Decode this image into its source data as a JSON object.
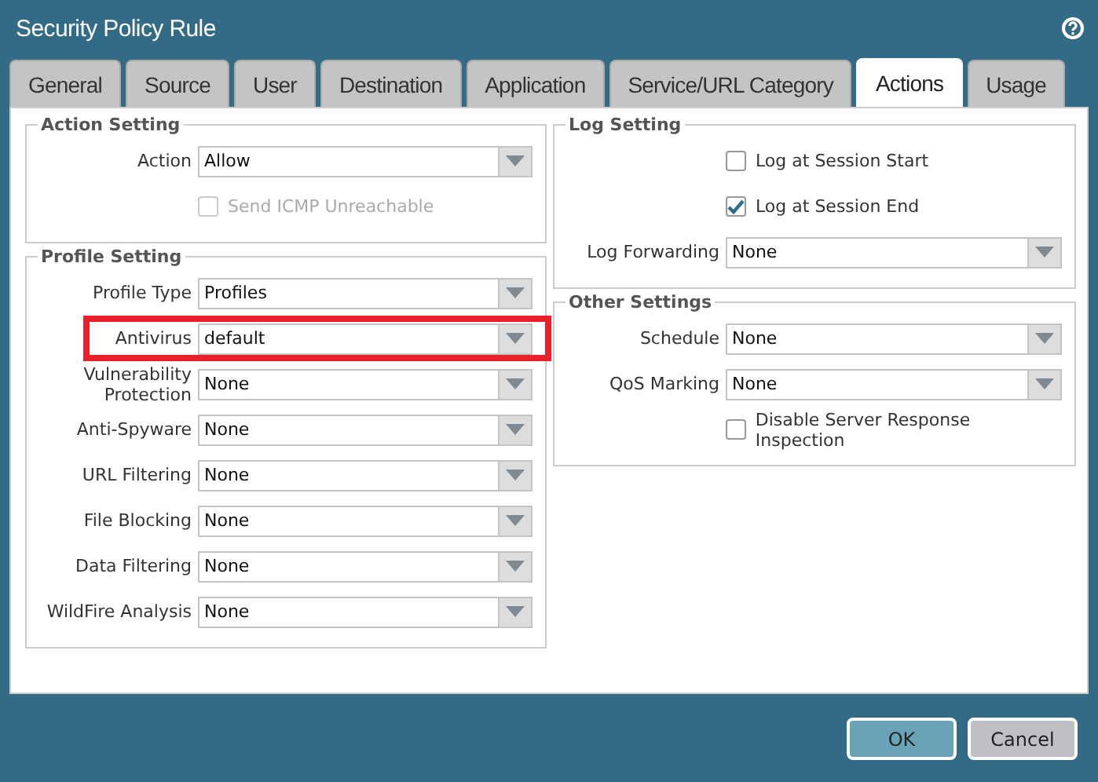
{
  "window": {
    "title": "Security Policy Rule"
  },
  "tabs": [
    {
      "label": "General",
      "selected": false
    },
    {
      "label": "Source",
      "selected": false
    },
    {
      "label": "User",
      "selected": false
    },
    {
      "label": "Destination",
      "selected": false
    },
    {
      "label": "Application",
      "selected": false
    },
    {
      "label": "Service/URL Category",
      "selected": false
    },
    {
      "label": "Actions",
      "selected": true
    },
    {
      "label": "Usage",
      "selected": false
    }
  ],
  "left_sections": [
    {
      "title": "Action Setting",
      "rows": [
        {
          "kind": "select",
          "label": "Action",
          "value": "Allow"
        },
        {
          "kind": "checkbox",
          "label": "Send ICMP Unreachable",
          "checked": false,
          "disabled": true
        }
      ]
    },
    {
      "title": "Profile Setting",
      "rows": [
        {
          "kind": "select",
          "label": "Profile Type",
          "value": "Profiles"
        },
        {
          "kind": "select",
          "label": "Antivirus",
          "value": "default",
          "highlighted": true
        },
        {
          "kind": "select",
          "label": "Vulnerability Protection",
          "value": "None"
        },
        {
          "kind": "select",
          "label": "Anti-Spyware",
          "value": "None"
        },
        {
          "kind": "select",
          "label": "URL Filtering",
          "value": "None"
        },
        {
          "kind": "select",
          "label": "File Blocking",
          "value": "None"
        },
        {
          "kind": "select",
          "label": "Data Filtering",
          "value": "None"
        },
        {
          "kind": "select",
          "label": "WildFire Analysis",
          "value": "None"
        }
      ]
    }
  ],
  "right_sections": [
    {
      "title": "Log Setting",
      "rows": [
        {
          "kind": "checkbox",
          "label": "Log at Session Start",
          "checked": false,
          "disabled": false
        },
        {
          "kind": "checkbox",
          "label": "Log at Session End",
          "checked": true,
          "disabled": false
        },
        {
          "kind": "select",
          "label": "Log Forwarding",
          "value": "None"
        }
      ]
    },
    {
      "title": "Other Settings",
      "rows": [
        {
          "kind": "select",
          "label": "Schedule",
          "value": "None"
        },
        {
          "kind": "select",
          "label": "QoS Marking",
          "value": "None"
        },
        {
          "kind": "checkbox",
          "label": "Disable Server Response Inspection",
          "checked": false,
          "disabled": false
        }
      ]
    }
  ],
  "buttons": [
    {
      "label": "OK",
      "kind": "primary"
    },
    {
      "label": "Cancel",
      "kind": "secondary"
    }
  ]
}
